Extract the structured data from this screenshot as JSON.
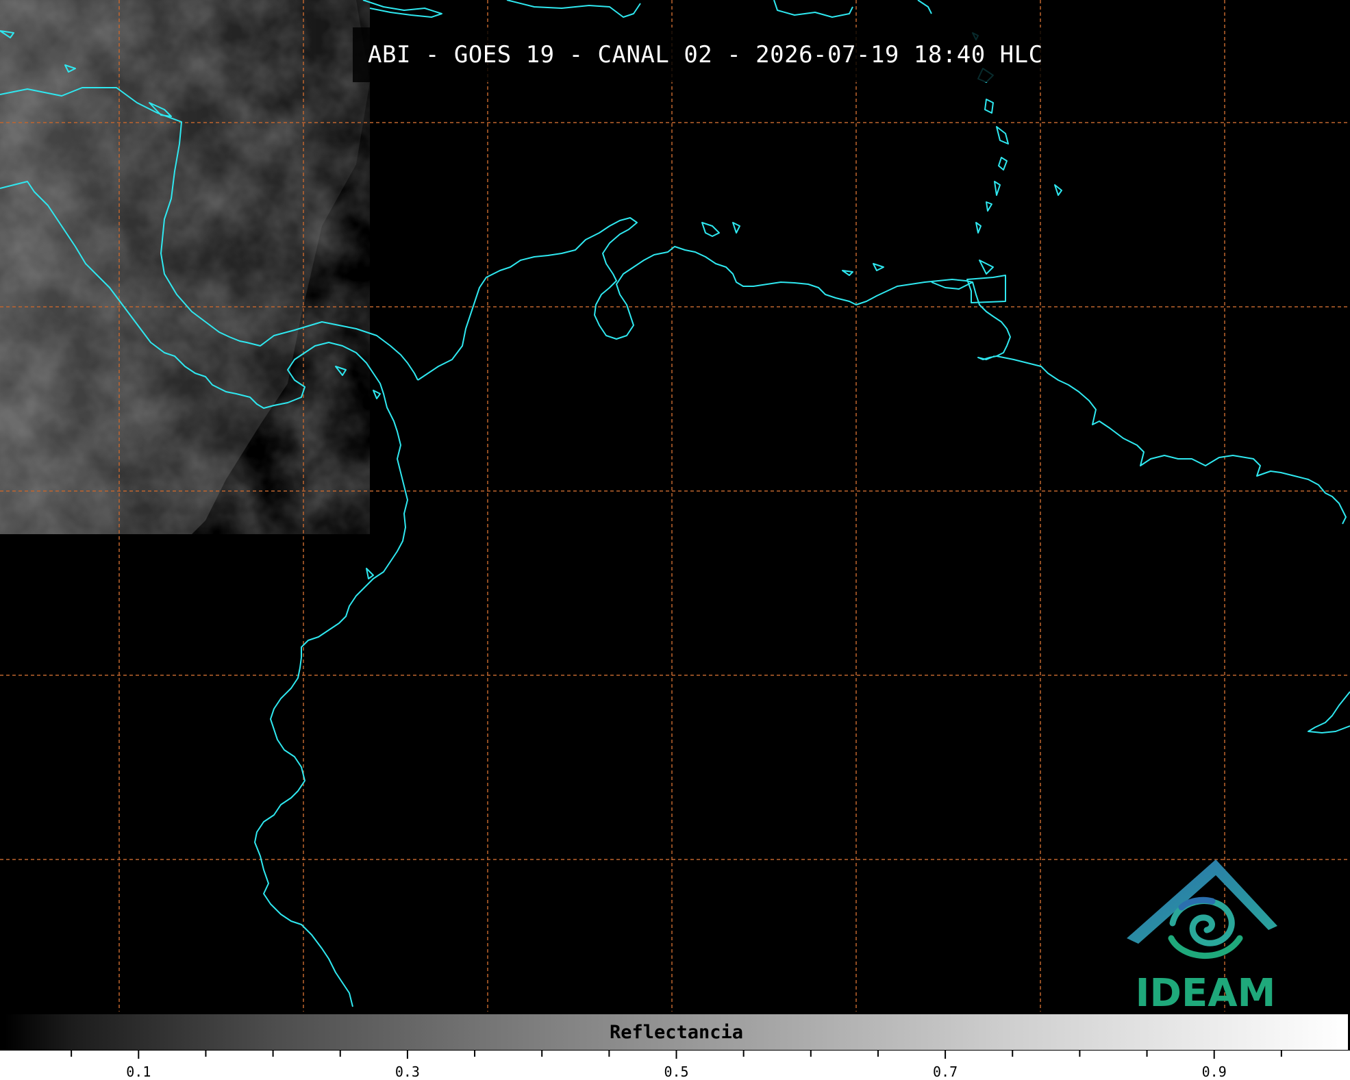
{
  "title": "ABI - GOES 19 - CANAL 02 - 2026-07-19 18:40 HLC",
  "logo": {
    "icon": "ideam-logo-icon",
    "text": "IDEAM",
    "colors": {
      "roof": "#2b6fae",
      "swirl": "#2aa89a",
      "text": "#1fa97b"
    }
  },
  "colorbar": {
    "label": "Reflectancia",
    "tick_labels": [
      "0.1",
      "0.3",
      "0.5",
      "0.7",
      "0.9"
    ],
    "ticks": [
      0.1,
      0.3,
      0.5,
      0.7,
      0.9
    ],
    "range": [
      0.0,
      1.0
    ],
    "colormap": "grayscale"
  },
  "map": {
    "coastline_color": "#2fe8f0",
    "gridline_color": "#c0652e",
    "gridline_style": "dashed",
    "background_color": "#000000"
  }
}
